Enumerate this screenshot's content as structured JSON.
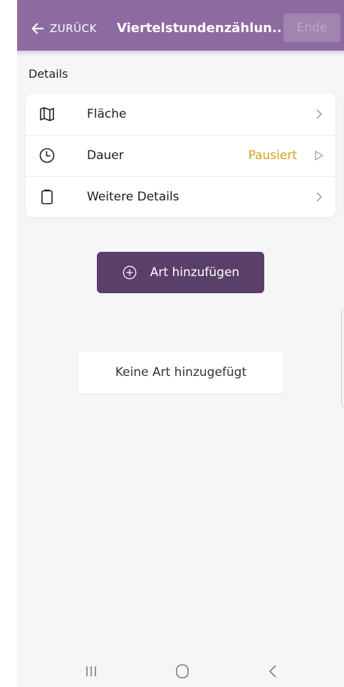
{
  "header": {
    "back_label": "ZURÜCK",
    "title": "Viertelstundenzählun...",
    "end_label": "Ende"
  },
  "details": {
    "section_title": "Details",
    "rows": [
      {
        "label": "Fläche",
        "icon": "map-icon",
        "status": ""
      },
      {
        "label": "Dauer",
        "icon": "clock-icon",
        "status": "Pausiert"
      },
      {
        "label": "Weitere Details",
        "icon": "clipboard-icon",
        "status": ""
      }
    ]
  },
  "add_species": {
    "label": "Art hinzufügen",
    "icon": "plus-circle-icon"
  },
  "empty_state": {
    "label": "Keine Art hinzugefügt"
  },
  "navbar": {
    "icons": [
      "recents-icon",
      "home-icon",
      "back-icon"
    ]
  },
  "colors": {
    "header": "#8d6aa0",
    "primary_button": "#5a4068",
    "status": "#d4a020",
    "background": "#f6f6f8"
  }
}
